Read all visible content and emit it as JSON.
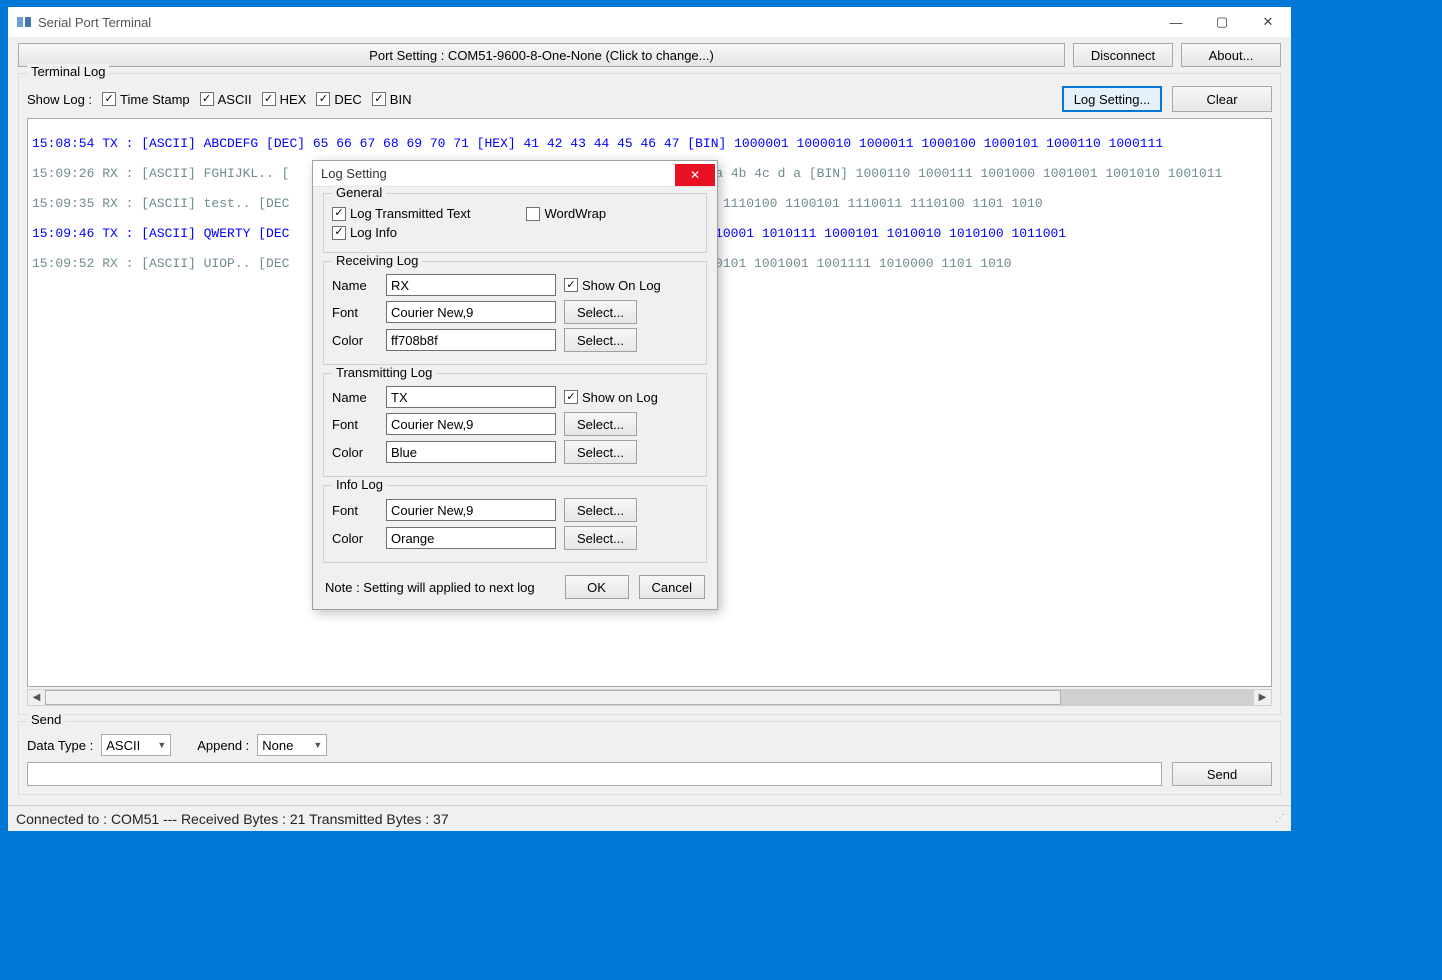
{
  "window": {
    "title": "Serial Port Terminal",
    "min": "—",
    "max": "▢",
    "close": "✕"
  },
  "topbar": {
    "port_setting": "Port Setting : COM51-9600-8-One-None (Click to change...)",
    "disconnect": "Disconnect",
    "about": "About..."
  },
  "terminal": {
    "group": "Terminal Log",
    "show_log": "Show Log :",
    "chk_timestamp": "Time Stamp",
    "chk_ascii": "ASCII",
    "chk_hex": "HEX",
    "chk_dec": "DEC",
    "chk_bin": "BIN",
    "btn_log_setting": "Log Setting...",
    "btn_clear": "Clear",
    "log_lines": {
      "l1": "15:08:54 TX : [ASCII] ABCDEFG [DEC] 65 66 67 68 69 70 71 [HEX] 41 42 43 44 45 46 47 [BIN] 1000001 1000010 1000011 1000100 1000101 1000110 1000111",
      "l2a": "15:09:26 RX : [ASCII] FGHIJKL.. [",
      "l2b": "4a 4b 4c d a [BIN] 1000110 1000111 1001000 1001001 1001010 1001011",
      "l3a": "15:09:35 RX : [ASCII] test.. [DEC",
      "l3b": "N] 1110100 1100101 1110011 1110100 1101 1010",
      "l4a": "15:09:46 TX : [ASCII] QWERTY [DEC",
      "l4b": "1010001 1010111 1000101 1010010 1010100 1011001",
      "l5a": "15:09:52 RX : [ASCII] UIOP.. [DEC",
      "l5b": "010101 1001001 1001111 1010000 1101 1010"
    }
  },
  "send": {
    "group": "Send",
    "data_type_label": "Data Type :",
    "data_type_value": "ASCII",
    "append_label": "Append :",
    "append_value": "None",
    "btn_send": "Send"
  },
  "status": {
    "text": "Connected to : COM51  ---  Received Bytes :  21  Transmitted Bytes :  37"
  },
  "dialog": {
    "title": "Log Setting",
    "close": "✕",
    "general": {
      "legend": "General",
      "log_tx": "Log Transmitted Text",
      "wordwrap": "WordWrap",
      "log_info": "Log Info"
    },
    "rx": {
      "legend": "Receiving Log",
      "name_label": "Name",
      "name_value": "RX",
      "show_on_log": "Show On Log",
      "font_label": "Font",
      "font_value": "Courier New,9",
      "select": "Select...",
      "color_label": "Color",
      "color_value": "ff708b8f"
    },
    "tx": {
      "legend": "Transmitting Log",
      "name_label": "Name",
      "name_value": "TX",
      "show_on_log": "Show on Log",
      "font_label": "Font",
      "font_value": "Courier New,9",
      "select": "Select...",
      "color_label": "Color",
      "color_value": "Blue"
    },
    "info": {
      "legend": "Info Log",
      "font_label": "Font",
      "font_value": "Courier New,9",
      "select": "Select...",
      "color_label": "Color",
      "color_value": "Orange"
    },
    "footer": {
      "note": "Note : Setting will applied to next log",
      "ok": "OK",
      "cancel": "Cancel"
    }
  }
}
